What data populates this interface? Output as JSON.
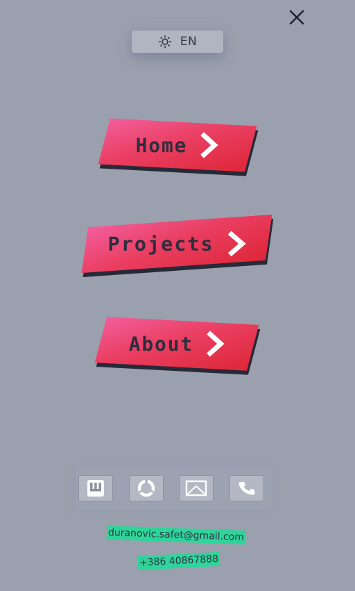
{
  "header": {
    "close_icon": "close-icon"
  },
  "settings": {
    "theme_icon": "sun-icon",
    "language": "EN"
  },
  "nav": {
    "items": [
      {
        "label": "Home",
        "icon": "chevron-right-icon"
      },
      {
        "label": "Projects",
        "icon": "chevron-right-icon"
      },
      {
        "label": "About",
        "icon": "chevron-right-icon"
      }
    ]
  },
  "social": {
    "links": [
      {
        "icon": "itch-io-icon"
      },
      {
        "icon": "circular-logo-icon"
      },
      {
        "icon": "image-icon"
      },
      {
        "icon": "phone-icon"
      }
    ]
  },
  "contact": {
    "email": "duranovic.safet@gmail.com",
    "phone": "+386 40867888"
  },
  "colors": {
    "background": "#9aa0ad",
    "button_gradient_start": "#f25e9b",
    "button_gradient_end": "#de2738",
    "button_shadow": "#272938",
    "contact_highlight": "#2ed59a",
    "text_dark": "#2c2e3d"
  }
}
